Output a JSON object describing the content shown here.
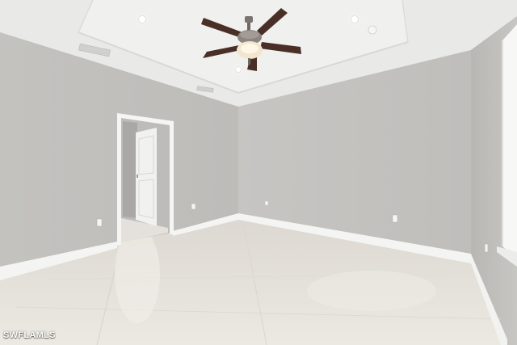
{
  "photo": {
    "subject": "empty-room-interior",
    "watermark": "SWFLAMLS",
    "colors": {
      "wall": "#c2c1be",
      "ceiling": "#ebebea",
      "floor": "#e6e2dc",
      "baseboard": "#f4f4f2",
      "fan_blade": "#4a2f26"
    }
  }
}
